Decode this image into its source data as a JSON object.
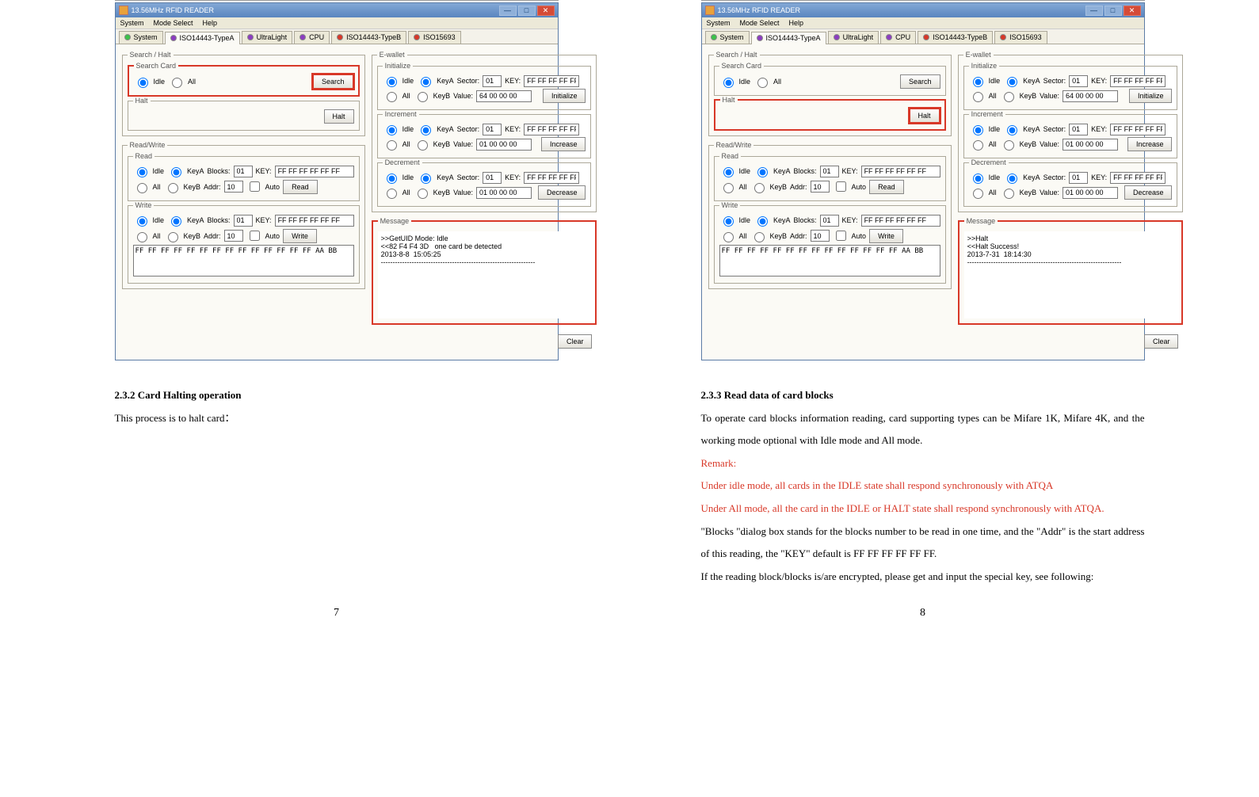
{
  "app_title": "13.56MHz RFID READER",
  "menubar": [
    "System",
    "Mode Select",
    "Help"
  ],
  "tabs": [
    {
      "label": "System",
      "color": "#3cc24a"
    },
    {
      "label": "ISO14443-TypeA",
      "color": "#8c3dc1"
    },
    {
      "label": "UltraLight",
      "color": "#8c3dc1"
    },
    {
      "label": "CPU",
      "color": "#8c3dc1"
    },
    {
      "label": "ISO14443-TypeB",
      "color": "#d83828"
    },
    {
      "label": "ISO15693",
      "color": "#d83828"
    }
  ],
  "labels": {
    "search_halt": "Search / Halt",
    "search_card": "Search Card",
    "idle": "Idle",
    "all": "All",
    "search": "Search",
    "halt": "Halt",
    "read_write": "Read/Write",
    "read": "Read",
    "write": "Write",
    "keya": "KeyA",
    "keyb": "KeyB",
    "blocks": "Blocks:",
    "key": "KEY:",
    "addr": "Addr:",
    "auto": "Auto",
    "ewallet": "E-wallet",
    "initialize_group": "Initialize",
    "increment": "Increment",
    "decrement": "Decrement",
    "sector": "Sector:",
    "value": "Value:",
    "initialize": "Initialize",
    "increase": "Increase",
    "decrease": "Decrease",
    "message": "Message",
    "clear": "Clear"
  },
  "defaults": {
    "blocks": "01",
    "addr": "10",
    "key6": "FF FF FF FF FF FF",
    "sector": "01",
    "val_init": "64 00 00 00",
    "val_incdec": "01 00 00 00",
    "writebuf": "FF FF FF FF FF FF FF FF FF FF FF FF FF FF AA BB"
  },
  "messages_left": ">>GetUID Mode: Idle\n<<82 F4 F4 3D   one card be detected\n2013-8-8  15:05:25\n-----------------------------------------------------------------",
  "messages_right": ">>Halt\n<<Halt Success!\n2013-7-31  18:14:30\n-----------------------------------------------------------------",
  "doc": {
    "h_left": "2.3.2    Card Halting operation",
    "p_left": "This process is to halt card：",
    "h_right": "2.3.3    Read data of card blocks",
    "p_r1": "To operate card blocks information reading, card supporting types can be Mifare 1K, Mifare 4K, and the working mode optional with Idle mode and All mode.",
    "remark": "Remark:",
    "p_r2": "Under idle mode,    all cards in the IDLE state shall respond synchronously with ATQA",
    "p_r3": "Under All mode, all the card in the IDLE or HALT state shall respond synchronously with ATQA.",
    "p_r4": "\"Blocks \"dialog box stands for the blocks number to be read in one time, and the \"Addr\" is the start address of this reading, the \"KEY\" default is FF FF FF FF FF FF.",
    "p_r5": "If the reading block/blocks is/are encrypted, please get and input the special key, see following:",
    "page_left": "7",
    "page_right": "8"
  }
}
